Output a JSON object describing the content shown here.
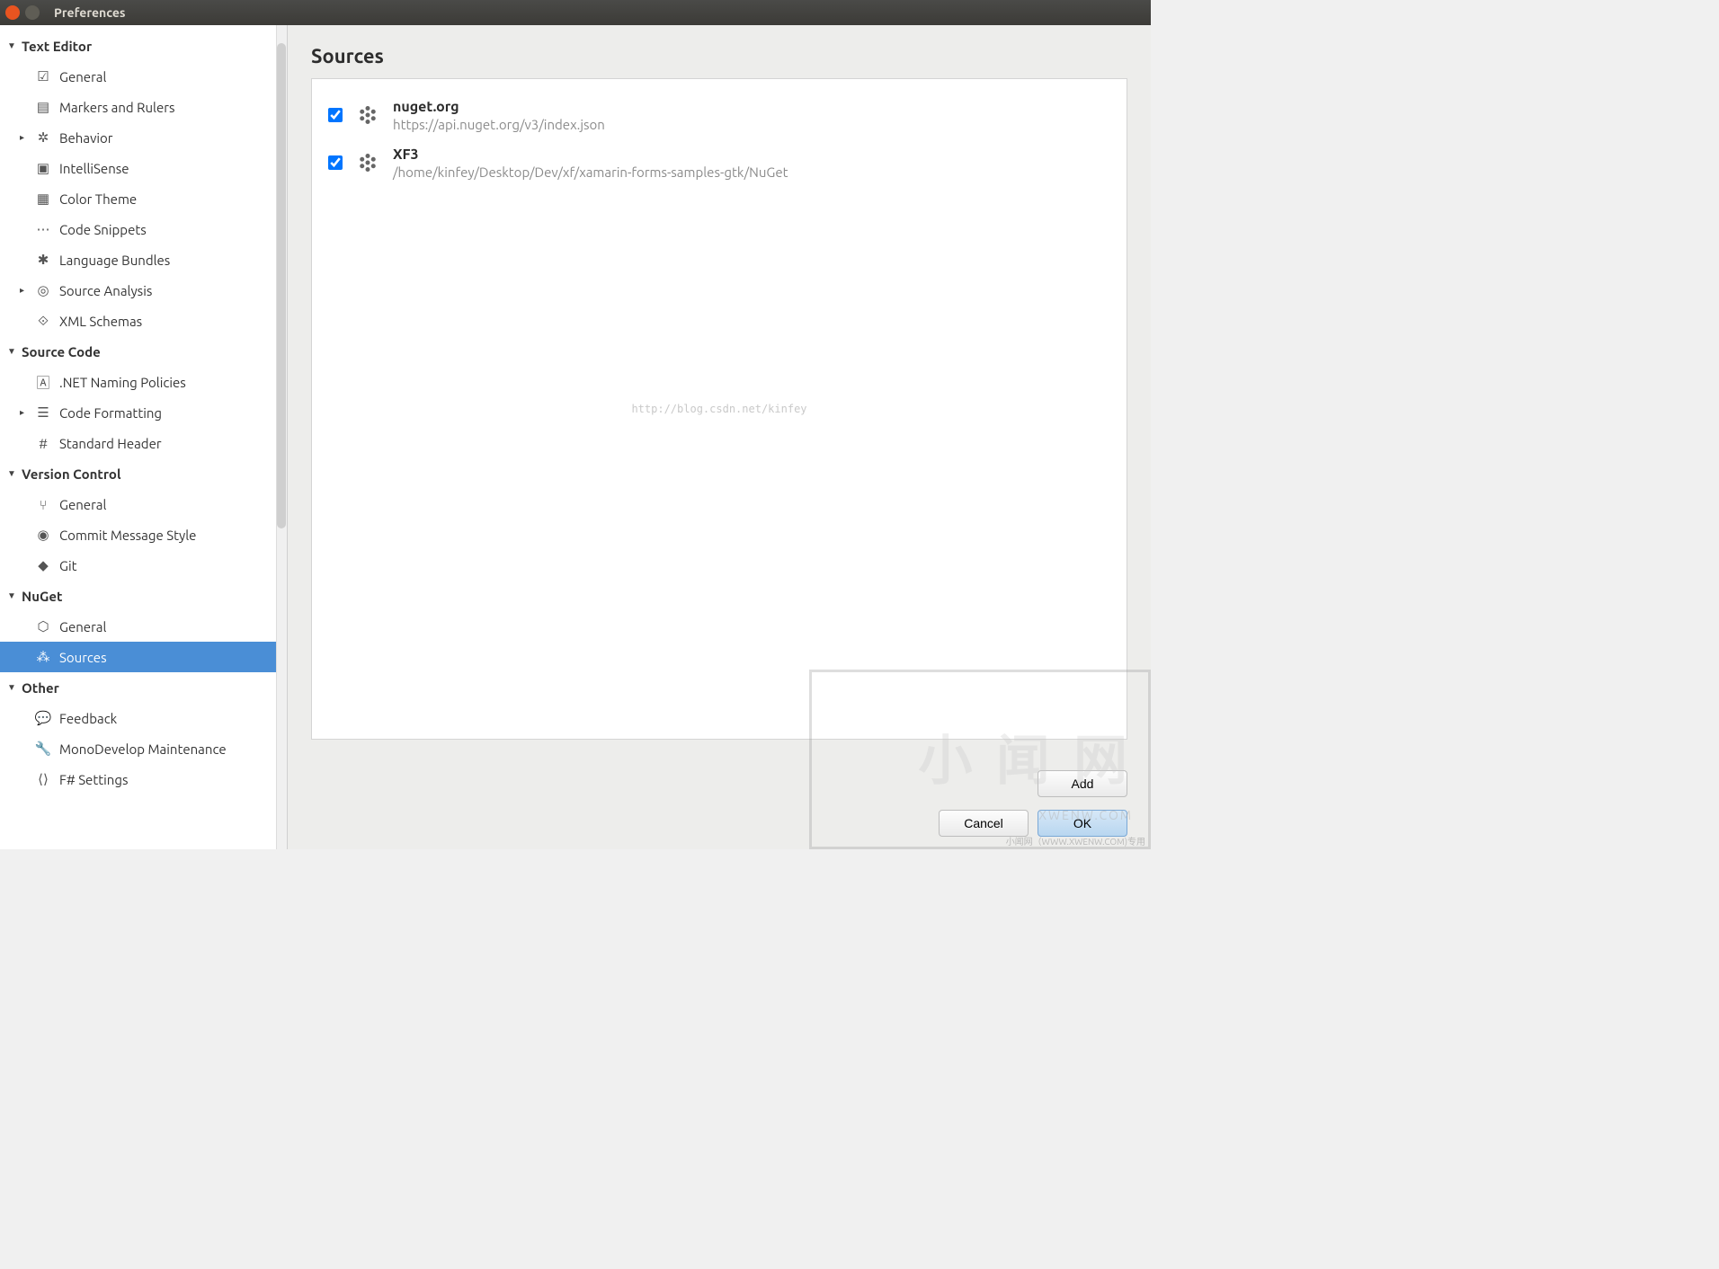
{
  "window": {
    "title": "Preferences"
  },
  "tree": {
    "textEditor": {
      "label": "Text Editor",
      "general": "General",
      "markers": "Markers and Rulers",
      "behavior": "Behavior",
      "intellisense": "IntelliSense",
      "colorTheme": "Color Theme",
      "codeSnippets": "Code Snippets",
      "languageBundles": "Language Bundles",
      "sourceAnalysis": "Source Analysis",
      "xmlSchemas": "XML Schemas"
    },
    "sourceCode": {
      "label": "Source Code",
      "netNaming": ".NET Naming Policies",
      "codeFormatting": "Code Formatting",
      "standardHeader": "Standard Header"
    },
    "versionControl": {
      "label": "Version Control",
      "general": "General",
      "commitStyle": "Commit Message Style",
      "git": "Git"
    },
    "nuget": {
      "label": "NuGet",
      "general": "General",
      "sources": "Sources"
    },
    "other": {
      "label": "Other",
      "feedback": "Feedback",
      "monodevelop": "MonoDevelop Maintenance",
      "fsharp": "F# Settings"
    }
  },
  "panel": {
    "title": "Sources",
    "watermark": "http://blog.csdn.net/kinfey",
    "sources": [
      {
        "name": "nuget.org",
        "url": "https://api.nuget.org/v3/index.json",
        "checked": true
      },
      {
        "name": "XF3",
        "url": "/home/kinfey/Desktop/Dev/xf/xamarin-forms-samples-gtk/NuGet",
        "checked": true
      }
    ]
  },
  "footer": {
    "add": "Add",
    "cancel": "Cancel",
    "ok": "OK"
  },
  "overlay": {
    "big": "小 闻 网",
    "small": "XWENW.COM",
    "foot": "小闻网（WWW.XWENW.COM)专用"
  }
}
